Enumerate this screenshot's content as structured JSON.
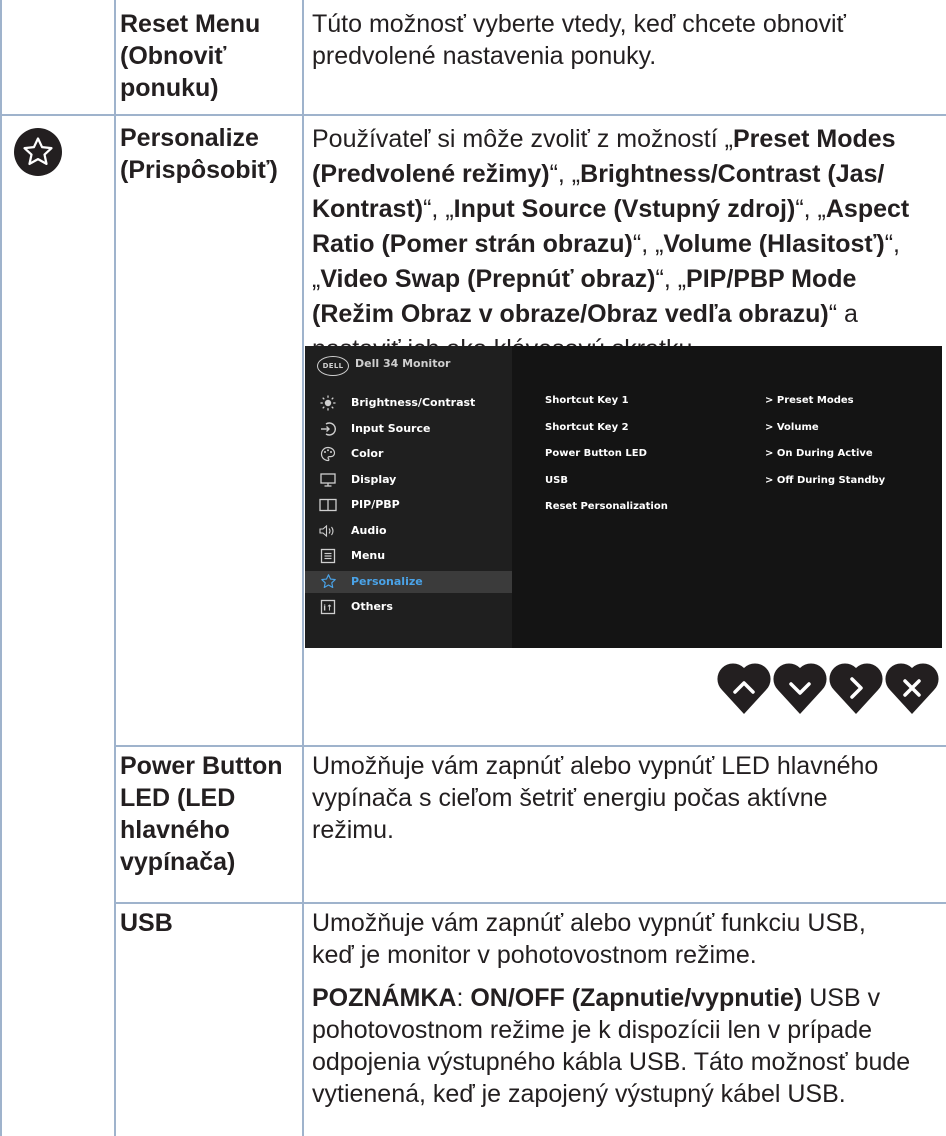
{
  "rows": {
    "reset_menu": {
      "label_lines": [
        "Reset Menu",
        "(Obnoviť",
        "ponuku)"
      ],
      "desc_lines": [
        "Túto možnosť vyberte vtedy, keď chcete obnoviť",
        "predvolené nastavenia ponuky."
      ]
    },
    "personalize": {
      "label_lines": [
        "Personalize",
        "(Prispôsobiť)"
      ],
      "icon": "star-icon",
      "desc": {
        "l1_a": "Používateľ si môže zvoliť z možností „",
        "l1_b": "Preset Modes",
        "l2_a": "(Predvolené režimy)",
        "l2_b": "“, „",
        "l2_c": "Brightness/Contrast (Jas/",
        "l3_a": "Kontrast)",
        "l3_b": "“, „",
        "l3_c": "Input Source (Vstupný zdroj)",
        "l3_d": "“, „",
        "l3_e": "Aspect",
        "l4_a": "Ratio (Pomer strán obrazu)",
        "l4_b": "“, „",
        "l4_c": "Volume (Hlasitosť)",
        "l4_d": "“,",
        "l5_a": "„",
        "l5_b": "Video Swap (Prepnúť obraz)",
        "l5_c": "“, „",
        "l5_d": "PIP/PBP Mode",
        "l6_a": "(Režim Obraz v obraze/Obraz vedľa obrazu)",
        "l6_b": "“ a",
        "l7": "nastaviť ich ako klávesovú skratku."
      },
      "osd": {
        "logo": "DELL",
        "title": "Dell 34 Monitor",
        "menu": [
          {
            "label": "Brightness/Contrast",
            "icon": "sun-icon"
          },
          {
            "label": "Input Source",
            "icon": "input-icon"
          },
          {
            "label": "Color",
            "icon": "palette-icon"
          },
          {
            "label": "Display",
            "icon": "display-icon"
          },
          {
            "label": "PIP/PBP",
            "icon": "pip-icon"
          },
          {
            "label": "Audio",
            "icon": "speaker-icon"
          },
          {
            "label": "Menu",
            "icon": "menu-icon"
          },
          {
            "label": "Personalize",
            "icon": "star-icon",
            "selected": true
          },
          {
            "label": "Others",
            "icon": "others-icon"
          }
        ],
        "settings": [
          {
            "key": "Shortcut Key 1",
            "value": "> Preset Modes"
          },
          {
            "key": "Shortcut Key 2",
            "value": "> Volume"
          },
          {
            "key": "Power Button LED",
            "value": "> On During Active"
          },
          {
            "key": "USB",
            "value": "> Off During Standby"
          },
          {
            "key": "Reset Personalization",
            "value": ""
          }
        ],
        "selected_color": "#4aa3e8"
      },
      "nav_buttons": [
        "up-arrow-icon",
        "down-arrow-icon",
        "right-arrow-icon",
        "close-icon"
      ]
    },
    "power_led": {
      "label_lines": [
        "Power Button",
        "LED (LED",
        "hlavného",
        "vypínača)"
      ],
      "desc_lines": [
        "Umožňuje vám zapnúť alebo vypnúť LED hlavného",
        "vypínača s cieľom šetriť energiu počas aktívne",
        "režimu."
      ]
    },
    "usb": {
      "label": "USB",
      "desc_lines": [
        "Umožňuje vám zapnúť alebo vypnúť funkciu USB,",
        "keď je monitor v pohotovostnom režime."
      ],
      "note": {
        "b1": "POZNÁMKA",
        "t1": ": ",
        "b2": "ON/OFF (Zapnutie/vypnutie)",
        "t2": " USB v",
        "l2": "pohotovostnom režime je k dispozícii len v prípade",
        "l3": "odpojenia výstupného kábla USB. Táto možnosť bude",
        "l4": "vytienená, keď je zapojený výstupný kábel USB."
      }
    }
  },
  "colors": {
    "border": "#9fb3cc",
    "text": "#231f20",
    "osd_selected": "#4aa3e8"
  }
}
